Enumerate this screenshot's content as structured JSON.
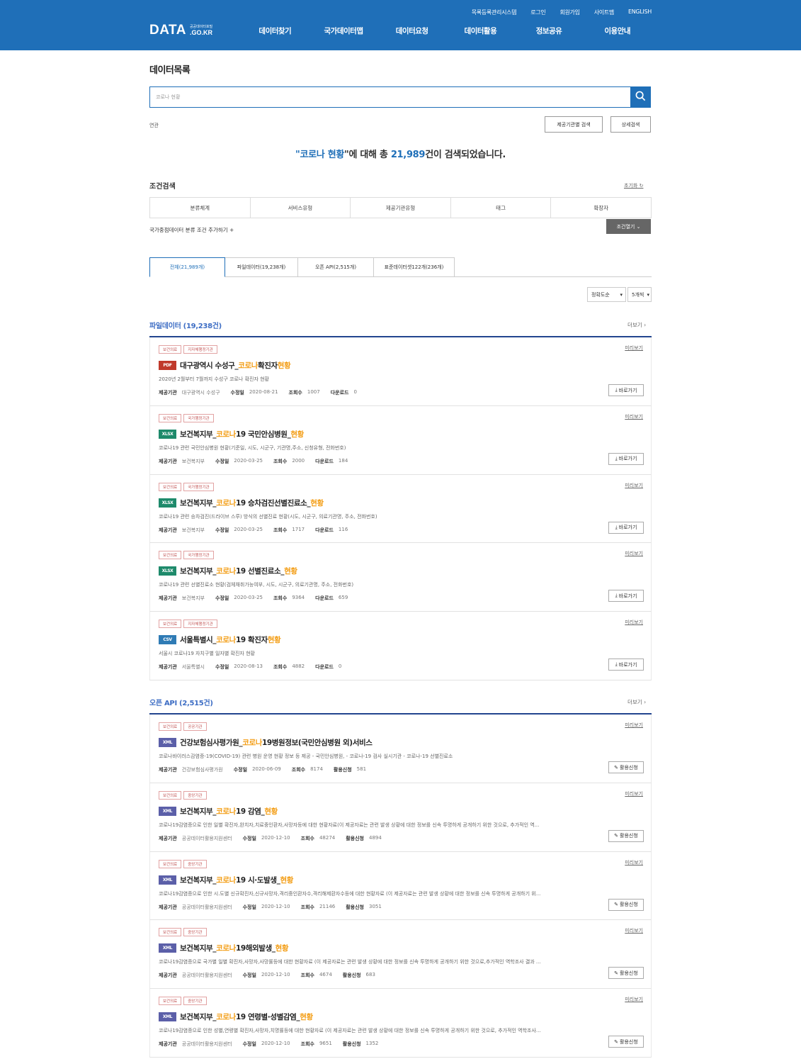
{
  "header": {
    "util": [
      "목록등록관리시스템",
      "로그인",
      "회원가입",
      "사이트맵",
      "ENGLISH"
    ],
    "logo": {
      "big": "DATA",
      "small_top": "공공데이터포털",
      "small_bottom": ".GO.KR"
    },
    "nav": [
      "데이터찾기",
      "국가데이터맵",
      "데이터요청",
      "데이터활용",
      "정보공유",
      "이용안내"
    ]
  },
  "page_title": "데이터목록",
  "search": {
    "value": "코로나 현황",
    "icon": "search-icon"
  },
  "related_label": "연관",
  "buttons": {
    "org_search": "제공기관별 검색",
    "detail_search": "상세검색"
  },
  "result": {
    "prefix": "\"",
    "keyword": "코로나 현황",
    "mid": "\"에 대해 총 ",
    "count": "21,989",
    "suffix": "건이 검색되었습니다."
  },
  "conditions": {
    "title": "조건검색",
    "reset": "초기화",
    "filters": [
      "분류체계",
      "서비스유형",
      "제공기관유형",
      "태그",
      "확장자"
    ],
    "add": "국가중점데이터 분류 조건 추가하기 +",
    "open": "조건열기"
  },
  "tabs": [
    "전체(21,989개)",
    "파일데이터(19,238개)",
    "오픈 API(2,515개)",
    "표준데이터셋122개(236개)"
  ],
  "sort": {
    "order": "정확도순",
    "size": "5개씩"
  },
  "colors": {
    "header": "#1f6fb8",
    "pdf": "#c0392b",
    "xlsx": "#1e8a6b",
    "csv": "#2f7bb5",
    "xml": "#5b5fa8",
    "highlight": "#f39c12"
  },
  "file_section": {
    "title": "파일데이터 (19,238건)",
    "more": "더보기",
    "items": [
      {
        "badges": [
          "보건의료",
          "지자체행정기관"
        ],
        "type": "PDF",
        "pre": "대구광역시 수성구_",
        "hl": "코로나",
        "mid": " 확진자 ",
        "hl2": "현황",
        "post": "",
        "desc": "2020년 2월부터 7월까지 수성구 코로나 확진자 현황",
        "org_label": "제공기관",
        "org": "대구광역시 수성구",
        "date_label": "수정일",
        "date": "2020-08-21",
        "views_label": "조회수",
        "views": "1007",
        "dl_label": "다운로드",
        "dl": "0",
        "action": "바로가기",
        "preview": "미리보기"
      },
      {
        "badges": [
          "보건의료",
          "국가행정기관"
        ],
        "type": "XLSX",
        "pre": "보건복지부_",
        "hl": "코로나",
        "mid": "19 국민안심병원_",
        "hl2": "현황",
        "post": "",
        "desc": "코로나19 관련 국민안심병원 현황(기준일, 시도, 시군구, 기관명,주소, 신청유형, 전화번호)",
        "org_label": "제공기관",
        "org": "보건복지부",
        "date_label": "수정일",
        "date": "2020-03-25",
        "views_label": "조회수",
        "views": "2000",
        "dl_label": "다운로드",
        "dl": "184",
        "action": "바로가기",
        "preview": "미리보기"
      },
      {
        "badges": [
          "보건의료",
          "국가행정기관"
        ],
        "type": "XLSX",
        "pre": "보건복지부_",
        "hl": "코로나",
        "mid": "19 승차검진선별진료소_",
        "hl2": "현황",
        "post": "",
        "desc": "코로나19 관련 승차검진(드라이브 스루) 방식의 선별진료 현황(시도, 시군구, 의료기관명, 주소, 전화번호)",
        "org_label": "제공기관",
        "org": "보건복지부",
        "date_label": "수정일",
        "date": "2020-03-25",
        "views_label": "조회수",
        "views": "1717",
        "dl_label": "다운로드",
        "dl": "116",
        "action": "바로가기",
        "preview": "미리보기"
      },
      {
        "badges": [
          "보건의료",
          "국가행정기관"
        ],
        "type": "XLSX",
        "pre": "보건복지부_",
        "hl": "코로나",
        "mid": "19 선별진료소_",
        "hl2": "현황",
        "post": "",
        "desc": "코로나19 관련 선별진료소 현황(검체채취가능여부, 시도, 시군구, 의료기관명, 주소, 전화번호)",
        "org_label": "제공기관",
        "org": "보건복지부",
        "date_label": "수정일",
        "date": "2020-03-25",
        "views_label": "조회수",
        "views": "9364",
        "dl_label": "다운로드",
        "dl": "659",
        "action": "바로가기",
        "preview": "미리보기"
      },
      {
        "badges": [
          "보건의료",
          "지자체행정기관"
        ],
        "type": "CSV",
        "pre": "서울특별시_",
        "hl": "코로나",
        "mid": "19 확진자 ",
        "hl2": "현황",
        "post": "",
        "desc": "서울시 코로나19 자치구별 일자별 확진자 현황",
        "org_label": "제공기관",
        "org": "서울특별시",
        "date_label": "수정일",
        "date": "2020-08-13",
        "views_label": "조회수",
        "views": "4882",
        "dl_label": "다운로드",
        "dl": "0",
        "action": "바로가기",
        "preview": "미리보기"
      }
    ]
  },
  "api_section": {
    "title": "오픈 API (2,515건)",
    "more": "더보기",
    "items": [
      {
        "badges": [
          "보건의료",
          "공공기관"
        ],
        "type": "XML",
        "pre": "건강보험심사평가원_",
        "hl": "코로나",
        "mid": "19병원정보(국민안심병원 외)서비스",
        "hl2": "",
        "post": "",
        "desc": "코로나바이러스감염증-19(COVID-19) 관련 병원 운영 현황 정보 등 제공 - 국민안심병원, - 코로나-19 검사 실시기관 - 코로나-19 선별진료소",
        "org_label": "제공기관",
        "org": "건강보험심사평가원",
        "date_label": "수정일",
        "date": "2020-06-09",
        "views_label": "조회수",
        "views": "8174",
        "dl_label": "활용신청",
        "dl": "581",
        "action": "활용신청",
        "preview": "미리보기"
      },
      {
        "badges": [
          "보건의료",
          "중앙기관"
        ],
        "type": "XML",
        "pre": "보건복지부_",
        "hl": "코로나",
        "mid": "19 감염_",
        "hl2": "현황",
        "post": "",
        "desc": "코로나19감염증으로 인한 일별 확진자,완치자,치료중인환자,사망자등에 대한 현황자료(이 제공자료는 관련 발생 상황에 대한 정보를 신속 투명하게 공개하기 위한 것으로, 추가적인 역...",
        "org_label": "제공기관",
        "org": "공공데이터활용지원센터",
        "date_label": "수정일",
        "date": "2020-12-10",
        "views_label": "조회수",
        "views": "48274",
        "dl_label": "활용신청",
        "dl": "4894",
        "action": "활용신청",
        "preview": "미리보기"
      },
      {
        "badges": [
          "보건의료",
          "중앙기관"
        ],
        "type": "XML",
        "pre": "보건복지부_",
        "hl": "코로나",
        "mid": "19 시·도발생_",
        "hl2": "현황",
        "post": "",
        "desc": "코로나19감염증으로 인한 시.도별 신규확진자,신규사망자,격리중인환자수,격리해제환자수등에 대한 현황자료 (이 제공자료는 관련 발생 상황에 대한 정보를 신속 투명하게 공개하기 위...",
        "org_label": "제공기관",
        "org": "공공데이터활용지원센터",
        "date_label": "수정일",
        "date": "2020-12-10",
        "views_label": "조회수",
        "views": "21146",
        "dl_label": "활용신청",
        "dl": "3051",
        "action": "활용신청",
        "preview": "미리보기"
      },
      {
        "badges": [
          "보건의료",
          "중앙기관"
        ],
        "type": "XML",
        "pre": "보건복지부_",
        "hl": "코로나",
        "mid": "19해외발생_",
        "hl2": "현황",
        "post": "",
        "desc": "코로나19감염증으로 국가별 일별 확진자,사망자,사망률등에 대한 현황자료 (이 제공자료는 관련 발생 상황에 대한 정보를 신속 투명하게 공개하기 위한 것으로,추가적인 역학조사 결과 ...",
        "org_label": "제공기관",
        "org": "공공데이터활용지원센터",
        "date_label": "수정일",
        "date": "2020-12-10",
        "views_label": "조회수",
        "views": "4674",
        "dl_label": "활용신청",
        "dl": "683",
        "action": "활용신청",
        "preview": "미리보기"
      },
      {
        "badges": [
          "보건의료",
          "중앙기관"
        ],
        "type": "XML",
        "pre": "보건복지부_",
        "hl": "코로나",
        "mid": "19 연령별·성별감염_",
        "hl2": "현황",
        "post": "",
        "desc": "코로나19감염증으로 인한 성별,연령별 확진자,사망자,치명률등에 대한 현황자료 (이 제공자료는 관련 발생 상황에 대한 정보를 신속 투명하게 공개하기 위한 것으로, 추가적인 역학조사...",
        "org_label": "제공기관",
        "org": "공공데이터활용지원센터",
        "date_label": "수정일",
        "date": "2020-12-10",
        "views_label": "조회수",
        "views": "9651",
        "dl_label": "활용신청",
        "dl": "1352",
        "action": "활용신청",
        "preview": "미리보기"
      }
    ]
  }
}
